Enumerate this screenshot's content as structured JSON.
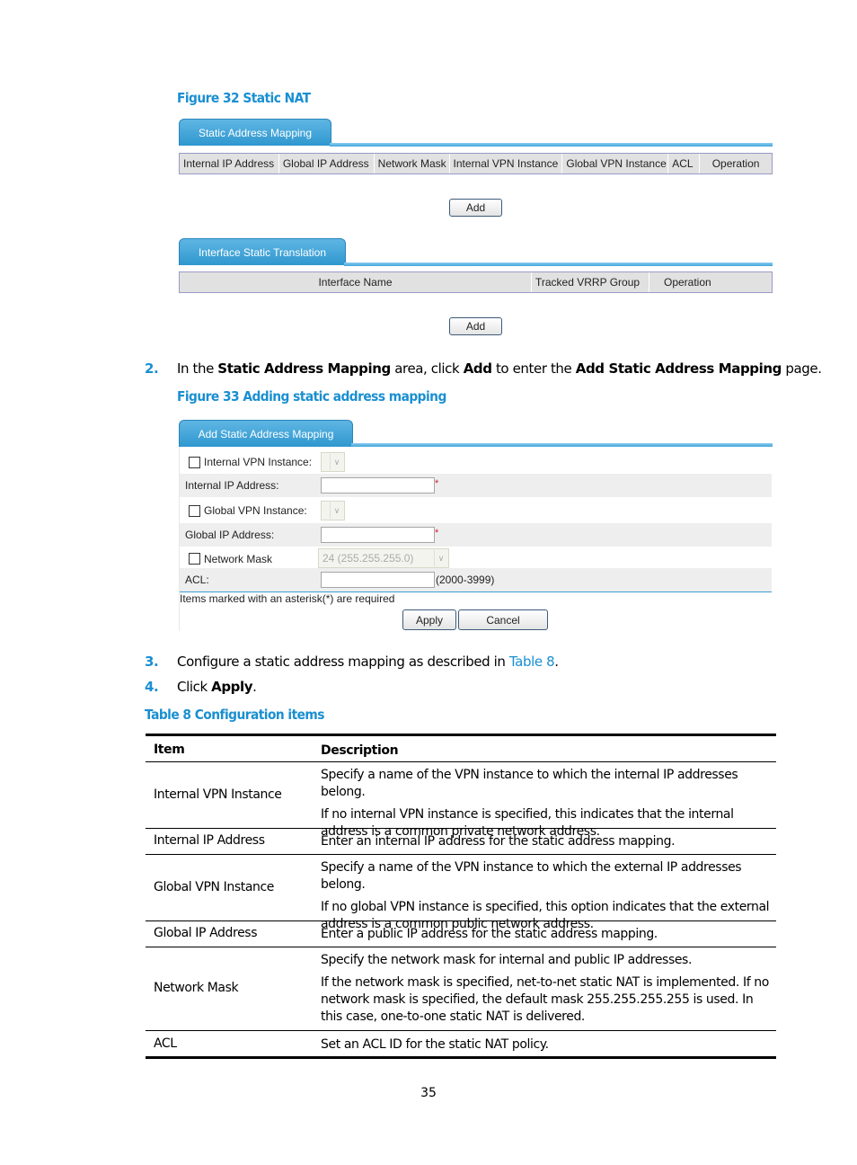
{
  "figure32": {
    "caption": "Figure 32 Static NAT",
    "section1": {
      "tab": "Static Address Mapping",
      "columns": [
        "Internal IP Address",
        "Global IP Address",
        "Network Mask",
        "Internal VPN Instance",
        "Global VPN Instance",
        "ACL",
        "Operation"
      ],
      "add_label": "Add"
    },
    "section2": {
      "tab": "Interface Static Translation",
      "columns": [
        "Interface Name",
        "Tracked VRRP Group",
        "Operation"
      ],
      "add_label": "Add"
    }
  },
  "step2": {
    "num": "2.",
    "parts": [
      "In the ",
      "Static Address Mapping",
      " area, click ",
      "Add",
      " to enter the ",
      "Add Static Address Mapping",
      " page."
    ]
  },
  "figure33": {
    "caption": "Figure 33 Adding static address mapping",
    "tab": "Add Static Address Mapping",
    "fields": {
      "internal_vpn": {
        "label": "Internal VPN Instance:",
        "checked": false,
        "value": ""
      },
      "internal_ip": {
        "label": "Internal IP Address:",
        "value": "",
        "required_mark": "*"
      },
      "global_vpn": {
        "label": "Global VPN Instance:",
        "checked": false,
        "value": ""
      },
      "global_ip": {
        "label": "Global IP Address:",
        "value": "",
        "required_mark": "*"
      },
      "network_mask": {
        "label": "Network Mask",
        "checked": false,
        "value": "24 (255.255.255.0)"
      },
      "acl": {
        "label": "ACL:",
        "value": "",
        "hint": "(2000-3999)"
      }
    },
    "note": "Items marked with an asterisk(*) are required",
    "apply_label": "Apply",
    "cancel_label": "Cancel"
  },
  "step3": {
    "num": "3.",
    "text_before": "Configure a static address mapping as described in ",
    "link": "Table 8",
    "text_after": "."
  },
  "step4": {
    "num": "4.",
    "text_before": "Click ",
    "bold": "Apply",
    "text_after": "."
  },
  "table8": {
    "caption": "Table 8 Configuration items",
    "headers": [
      "Item",
      "Description"
    ],
    "rows": [
      {
        "item": "Internal VPN Instance",
        "desc": [
          "Specify a name of the VPN instance to which the internal IP addresses belong.",
          "If no internal VPN instance is specified, this indicates that the internal address is a common private network address."
        ]
      },
      {
        "item": "Internal IP Address",
        "desc": [
          "Enter an internal IP address for the static address mapping."
        ]
      },
      {
        "item": "Global VPN Instance",
        "desc": [
          "Specify a name of the VPN instance to which the external IP addresses belong.",
          "If no global VPN instance is specified, this option indicates that the external address is a common public network address."
        ]
      },
      {
        "item": "Global IP Address",
        "desc": [
          "Enter a public IP address for the static address mapping."
        ]
      },
      {
        "item": "Network Mask",
        "desc": [
          "Specify the network mask for internal and public IP addresses.",
          "If the network mask is specified, net-to-net static NAT is implemented. If no network mask is specified, the default mask 255.255.255.255 is used. In this case, one-to-one static NAT is delivered."
        ]
      },
      {
        "item": "ACL",
        "desc": [
          "Set an ACL ID for the static NAT policy."
        ]
      }
    ]
  },
  "page_number": "35",
  "colors": {
    "accent": "#1a8fd1",
    "tab_blue": "#3a9ed3",
    "required": "#d0203a"
  }
}
